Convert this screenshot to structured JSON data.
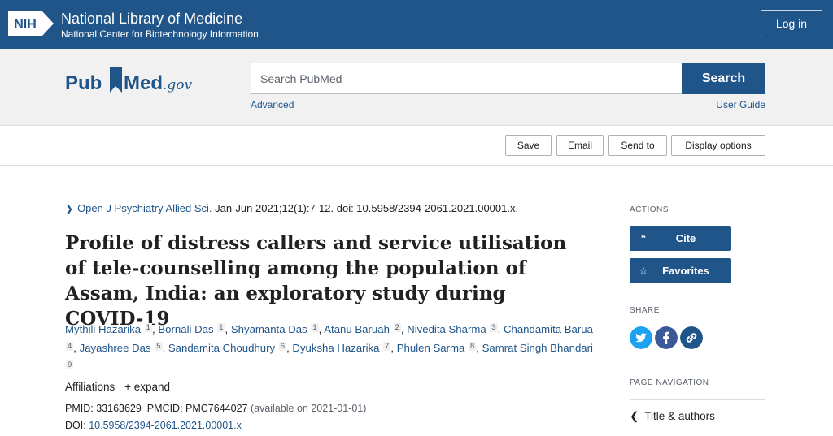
{
  "nih": {
    "logo_text": "NIH",
    "title": "National Library of Medicine",
    "subtitle": "National Center for Biotechnology Information",
    "login_label": "Log in"
  },
  "search": {
    "logo_pub": "Pub",
    "logo_med": "Med",
    "logo_gov": ".gov",
    "placeholder": "Search PubMed",
    "button_label": "Search",
    "advanced_label": "Advanced",
    "user_guide_label": "User Guide"
  },
  "actions_bar": {
    "save": "Save",
    "email": "Email",
    "send_to": "Send to",
    "display_options": "Display options"
  },
  "article": {
    "journal": "Open J Psychiatry Allied Sci.",
    "citation_rest": " Jan-Jun 2021;12(1):7-12. doi: 10.5958/2394-2061.2021.00001.x.",
    "title": "Profile of distress callers and service utilisation of tele-counselling among the population of Assam, India: an exploratory study during COVID-19",
    "authors": [
      {
        "name": "Mythili Hazarika",
        "sup": "1"
      },
      {
        "name": "Bornali Das",
        "sup": "1"
      },
      {
        "name": "Shyamanta Das",
        "sup": "1"
      },
      {
        "name": "Atanu Baruah",
        "sup": "2"
      },
      {
        "name": "Nivedita Sharma",
        "sup": "3"
      },
      {
        "name": "Chandamita Barua",
        "sup": "4"
      },
      {
        "name": "Jayashree Das",
        "sup": "5"
      },
      {
        "name": "Sandamita Choudhury",
        "sup": "6"
      },
      {
        "name": "Dyuksha Hazarika",
        "sup": "7"
      },
      {
        "name": "Phulen Sarma",
        "sup": "8"
      },
      {
        "name": "Samrat Singh Bhandari",
        "sup": "9"
      }
    ],
    "affiliations_label": "Affiliations",
    "expand_label": "+ expand",
    "pmid_label": "PMID:",
    "pmid": "33163629",
    "pmcid_label": "PMCID:",
    "pmcid": "PMC7644027",
    "pmcid_note": "(available on 2021-01-01)",
    "doi_label": "DOI:",
    "doi": "10.5958/2394-2061.2021.00001.x"
  },
  "sidebar": {
    "actions_heading": "ACTIONS",
    "cite_label": "Cite",
    "favorites_label": "Favorites",
    "share_heading": "SHARE",
    "page_nav_heading": "PAGE NAVIGATION",
    "nav_title_authors": "Title & authors"
  },
  "colors": {
    "brand": "#20558a",
    "twitter": "#1da1f2",
    "facebook": "#3b5998"
  }
}
